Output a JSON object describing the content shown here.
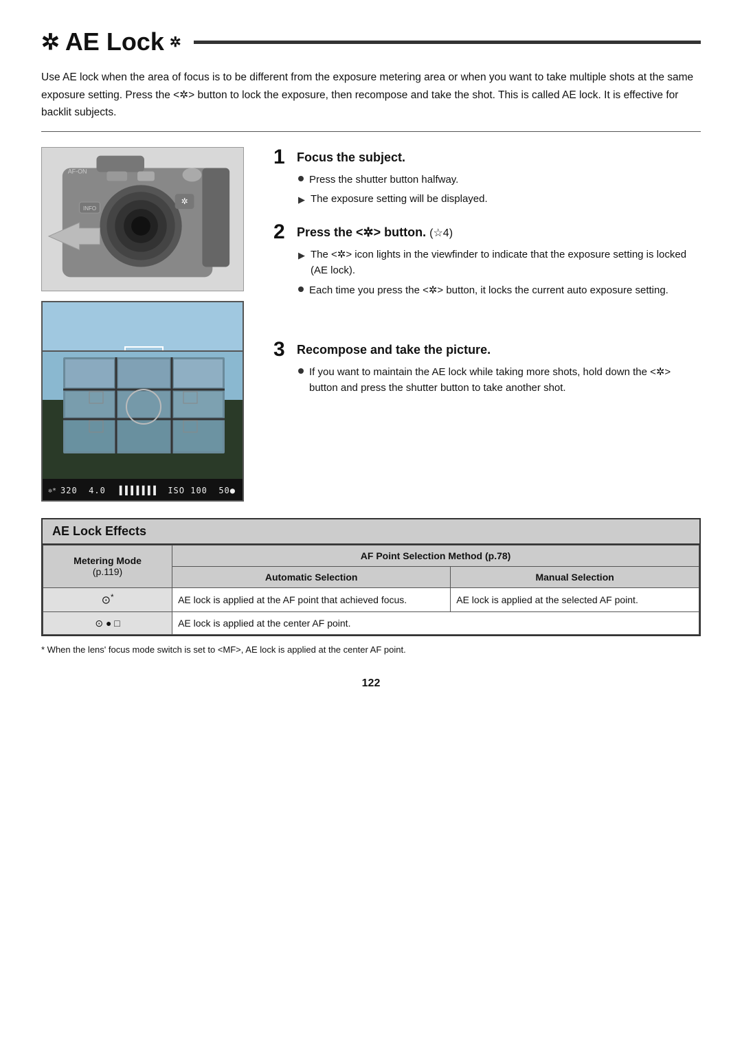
{
  "page": {
    "title_icon": "✲",
    "title_text": "AE Lock",
    "title_icon2": "✲",
    "intro": "Use AE lock when the area of focus is to be different from the exposure metering area or when you want to take multiple shots at the same exposure setting. Press the <✲> button to lock the exposure, then recompose and take the shot. This is called AE lock. It is effective for backlit subjects.",
    "step1": {
      "num": "1",
      "title": "Focus the subject.",
      "bullets": [
        {
          "type": "circle",
          "text": "Press the shutter button halfway."
        },
        {
          "type": "arrow",
          "text": "The exposure setting will be displayed."
        }
      ]
    },
    "step2": {
      "num": "2",
      "title": "Press the <✲> button.",
      "title_suffix": " (☆4)",
      "bullets": [
        {
          "type": "arrow",
          "text": "The <✲> icon lights in the viewfinder to indicate that the exposure setting is locked (AE lock)."
        },
        {
          "type": "circle",
          "text": "Each time you press the <✲> button, it locks the current auto exposure setting."
        }
      ]
    },
    "step3": {
      "num": "3",
      "title": "Recompose and take the picture.",
      "bullets": [
        {
          "type": "circle",
          "text": "If you want to maintain the AE lock while taking more shots, hold down the <✲> button and press the shutter button to take another shot."
        }
      ]
    },
    "ae_effects_section": {
      "title": "AE Lock Effects",
      "table": {
        "col_header1": "Metering Mode",
        "col_header1_sub": "(p.119)",
        "col_header2": "AF Point Selection Method (p.78)",
        "col_subheader2": "Automatic Selection",
        "col_subheader3": "Manual Selection",
        "rows": [
          {
            "label": "⊙*",
            "label_note": "",
            "auto_selection": "AE lock is applied at the AF point that achieved focus.",
            "manual_selection": "AE lock is applied at the selected AF point."
          },
          {
            "label": "⊙ ● □",
            "label_note": "",
            "auto_selection": "AE lock is applied at the center AF point.",
            "manual_selection": ""
          }
        ]
      },
      "footnote": "* When the lens' focus mode switch is set to <MF>, AE lock is applied at the center AF point."
    },
    "page_number": "122",
    "lcd1_status": "✲  320  4.0  ▐▐▐▐▐▐▐▐  ISO  100  50●",
    "lcd2_status": "✲*  320  4.0  ▐▐▐▐▐▐▐▐  ISO  100  50●"
  }
}
